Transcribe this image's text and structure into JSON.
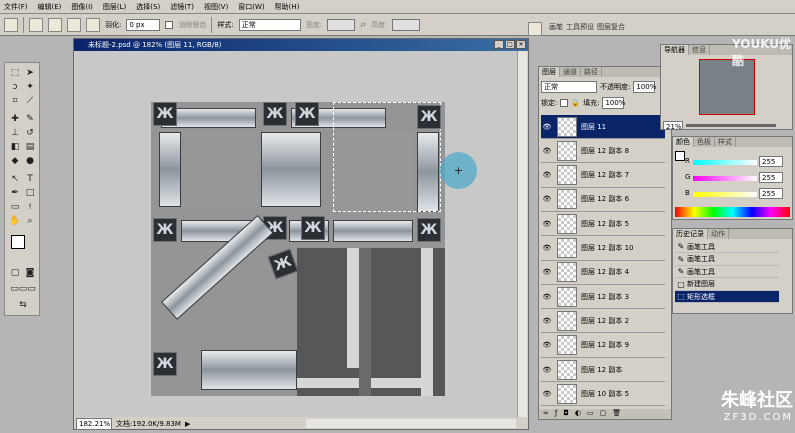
{
  "menu": [
    "文件(F)",
    "编辑(E)",
    "图像(I)",
    "图层(L)",
    "选择(S)",
    "滤镜(T)",
    "视图(V)",
    "窗口(W)",
    "帮助(H)"
  ],
  "options": {
    "feather_label": "羽化:",
    "feather_value": "0 px",
    "antialias_label": "消除锯齿",
    "style_label": "样式:",
    "style_value": "正常",
    "width_label": "宽度:",
    "height_label": "高度:"
  },
  "well_tabs": [
    "画笔",
    "工具预设",
    "图层复合"
  ],
  "document": {
    "title": "未标题-2.psd @ 182% (图层 11, RGB/8)",
    "zoom": "182.21%",
    "doc_info": "文档:192.0K/9.83M"
  },
  "layers_panel": {
    "tabs": [
      "图层",
      "通道",
      "路径"
    ],
    "blend_mode": "正常",
    "opacity_label": "不透明度:",
    "opacity_value": "100%",
    "lock_label": "锁定:",
    "fill_label": "填充:",
    "fill_value": "100%",
    "layers": [
      {
        "name": "图层 11",
        "selected": true
      },
      {
        "name": "图层 12 副本 8",
        "selected": false
      },
      {
        "name": "图层 12 副本 7",
        "selected": false
      },
      {
        "name": "图层 12 副本 6",
        "selected": false
      },
      {
        "name": "图层 12 副本 5",
        "selected": false
      },
      {
        "name": "图层 12 副本 10",
        "selected": false
      },
      {
        "name": "图层 12 副本 4",
        "selected": false
      },
      {
        "name": "图层 12 副本 3",
        "selected": false
      },
      {
        "name": "图层 12 副本 2",
        "selected": false
      },
      {
        "name": "图层 12 副本 9",
        "selected": false
      },
      {
        "name": "图层 12 副本",
        "selected": false
      },
      {
        "name": "图层 10 副本 5",
        "selected": false
      }
    ]
  },
  "navigator": {
    "tabs": [
      "导航器",
      "信息"
    ],
    "zoom": "21%"
  },
  "color_panel": {
    "tabs": [
      "颜色",
      "色板",
      "样式"
    ],
    "r_label": "R",
    "r_value": "255",
    "g_label": "G",
    "g_value": "255",
    "b_label": "B",
    "b_value": "255"
  },
  "history_panel": {
    "tabs": [
      "历史记录",
      "动作"
    ],
    "items": [
      {
        "name": "画笔工具",
        "icon": "brush-icon",
        "selected": false
      },
      {
        "name": "画笔工具",
        "icon": "brush-icon",
        "selected": false
      },
      {
        "name": "画笔工具",
        "icon": "brush-icon",
        "selected": false
      },
      {
        "name": "新建图层",
        "icon": "new-layer-icon",
        "selected": false
      },
      {
        "name": "矩形选框",
        "icon": "marquee-icon",
        "selected": true
      }
    ]
  },
  "watermarks": {
    "youku": "YOUKU优酷",
    "zhufeng": "朱峰社区",
    "zhufeng_url": "ZF3D.COM"
  },
  "colors": {
    "selection": "#0a246a",
    "cursor": "#50aac8"
  }
}
